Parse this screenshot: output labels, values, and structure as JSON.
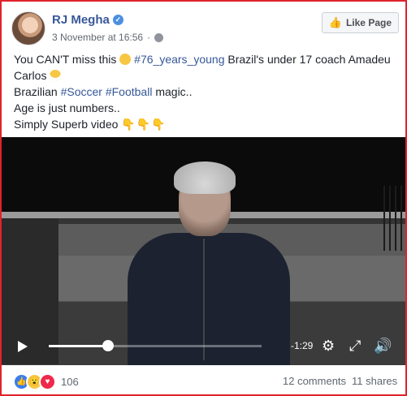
{
  "post": {
    "author": "RJ Megha",
    "timestamp": "3 November at 16:56",
    "like_page_label": "Like Page",
    "text": {
      "line1_a": "You CAN'T miss this",
      "hashtag_years": "#76_years_young",
      "line1_b": "Brazil's under 17 coach Amadeu",
      "line2": "Carlos",
      "line3_a": "Brazilian",
      "hashtag_soccer": "#Soccer",
      "hashtag_football": "#Football",
      "line3_b": "magic..",
      "line4": "Age is just numbers..",
      "line5": "Simply Superb video",
      "pointing_hands": "👇👇👇"
    }
  },
  "video": {
    "time_remaining": "-1:29",
    "progress_fraction": 0.28,
    "icons": [
      "play-icon",
      "settings-gear-icon",
      "fullscreen-icon",
      "volume-icon"
    ]
  },
  "footer": {
    "reaction_count": "106",
    "reactions": [
      "like",
      "wow",
      "love"
    ],
    "comments": "12 comments",
    "shares": "11 shares"
  },
  "colors": {
    "border": "#e0232b",
    "author_link": "#385898",
    "hashtag": "#365899"
  }
}
